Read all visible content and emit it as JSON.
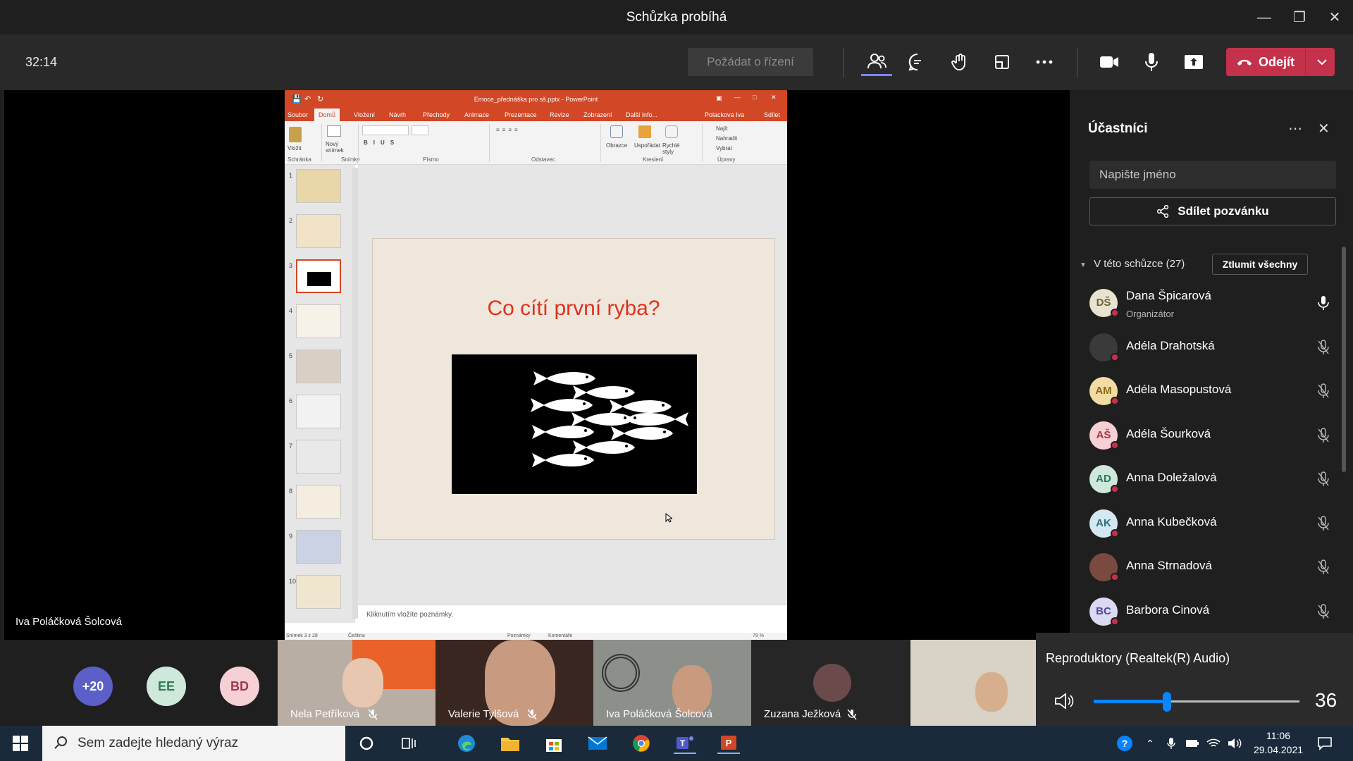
{
  "window": {
    "title": "Schůzka probíhá"
  },
  "toolbar": {
    "timer": "32:14",
    "request_control": "Požádat o řízení",
    "leave": "Odejít",
    "icons": [
      "people-icon",
      "chat-icon",
      "raise-hand-icon",
      "rooms-icon",
      "more-icon",
      "camera-icon",
      "mic-icon",
      "share-icon"
    ]
  },
  "presenter": {
    "name": "Iva Poláčková Šolcová"
  },
  "ppt": {
    "title": "Emoce_přednáška pro sš.pptx - PowerPoint",
    "user": "Polackova Iva",
    "share": "Sdílet",
    "tabs": [
      "Soubor",
      "Domů",
      "Vložení",
      "Návrh",
      "Přechody",
      "Animace",
      "Prezentace",
      "Revize",
      "Zobrazení",
      "Další info..."
    ],
    "ribbon": {
      "groups": [
        "Schránka",
        "Snímky",
        "Písmo",
        "Odstavec",
        "Kreslení",
        "Úpravy"
      ],
      "paste": "Vložit",
      "new_slide": "Nový snímek",
      "shapes": "Obrazce",
      "arrange": "Uspořádat",
      "quick_styles": "Rychlé styly",
      "find": "Najít",
      "replace": "Nahradit",
      "select": "Vybrat"
    },
    "slide_numbers": [
      "1",
      "2",
      "3",
      "4",
      "5",
      "6",
      "7",
      "8",
      "9",
      "10"
    ],
    "selected_slide": 3,
    "slide_title": "Co cítí první ryba?",
    "notes_placeholder": "Kliknutím vložíte poznámky.",
    "status": {
      "slide": "Snímek 3 z 28",
      "language": "Čeština",
      "notes": "Poznámky",
      "comments": "Komentáře",
      "zoom": "79 %"
    }
  },
  "panel": {
    "title": "Účastníci",
    "search_placeholder": "Napište jméno",
    "invite": "Sdílet pozvánku",
    "section": "V této schůzce (27)",
    "mute_all": "Ztlumit všechny",
    "participants": [
      {
        "initials": "DŠ",
        "name": "Dana Špicarová",
        "role": "Organizátor",
        "bg": "#e7e3cf",
        "fg": "#6b6436",
        "mic": "on"
      },
      {
        "initials": "",
        "name": "Adéla Drahotská",
        "role": "",
        "bg": "#3a3a3a",
        "fg": "#fff",
        "mic": "off"
      },
      {
        "initials": "AM",
        "name": "Adéla Masopustová",
        "role": "",
        "bg": "#f3dca3",
        "fg": "#8a6a14",
        "mic": "off"
      },
      {
        "initials": "AŠ",
        "name": "Adéla Šourková",
        "role": "",
        "bg": "#f6d0d4",
        "fg": "#a4374a",
        "mic": "off"
      },
      {
        "initials": "AD",
        "name": "Anna Doležalová",
        "role": "",
        "bg": "#cfe8dc",
        "fg": "#2f7a55",
        "mic": "off"
      },
      {
        "initials": "AK",
        "name": "Anna Kubečková",
        "role": "",
        "bg": "#d3e8f0",
        "fg": "#2d6d86",
        "mic": "off"
      },
      {
        "initials": "",
        "name": "Anna Strnadová",
        "role": "",
        "bg": "#7a4a3e",
        "fg": "#fff",
        "mic": "off"
      },
      {
        "initials": "BC",
        "name": "Barbora Cinová",
        "role": "",
        "bg": "#dcd9f2",
        "fg": "#4f4a9a",
        "mic": "off"
      }
    ]
  },
  "gallery": {
    "overflow": [
      {
        "label": "+20",
        "bg": "#5b5fc7",
        "fg": "#fff"
      },
      {
        "label": "EE",
        "bg": "#cfe8dc",
        "fg": "#2f7a55"
      },
      {
        "label": "BD",
        "bg": "#f6d0d4",
        "fg": "#a4374a"
      }
    ],
    "tiles": [
      {
        "name": "Nela Petříková",
        "muted": true
      },
      {
        "name": "Valerie Tylšová",
        "muted": true
      },
      {
        "name": "Iva Poláčková Šolcová",
        "muted": false
      },
      {
        "name": "Zuzana Ježková",
        "muted": true
      },
      {
        "name": "",
        "muted": false
      }
    ]
  },
  "speaker": {
    "device": "Reproduktory (Realtek(R) Audio)",
    "volume": 36
  },
  "taskbar": {
    "search_placeholder": "Sem zadejte hledaný výraz",
    "time": "11:06",
    "date": "29.04.2021"
  }
}
